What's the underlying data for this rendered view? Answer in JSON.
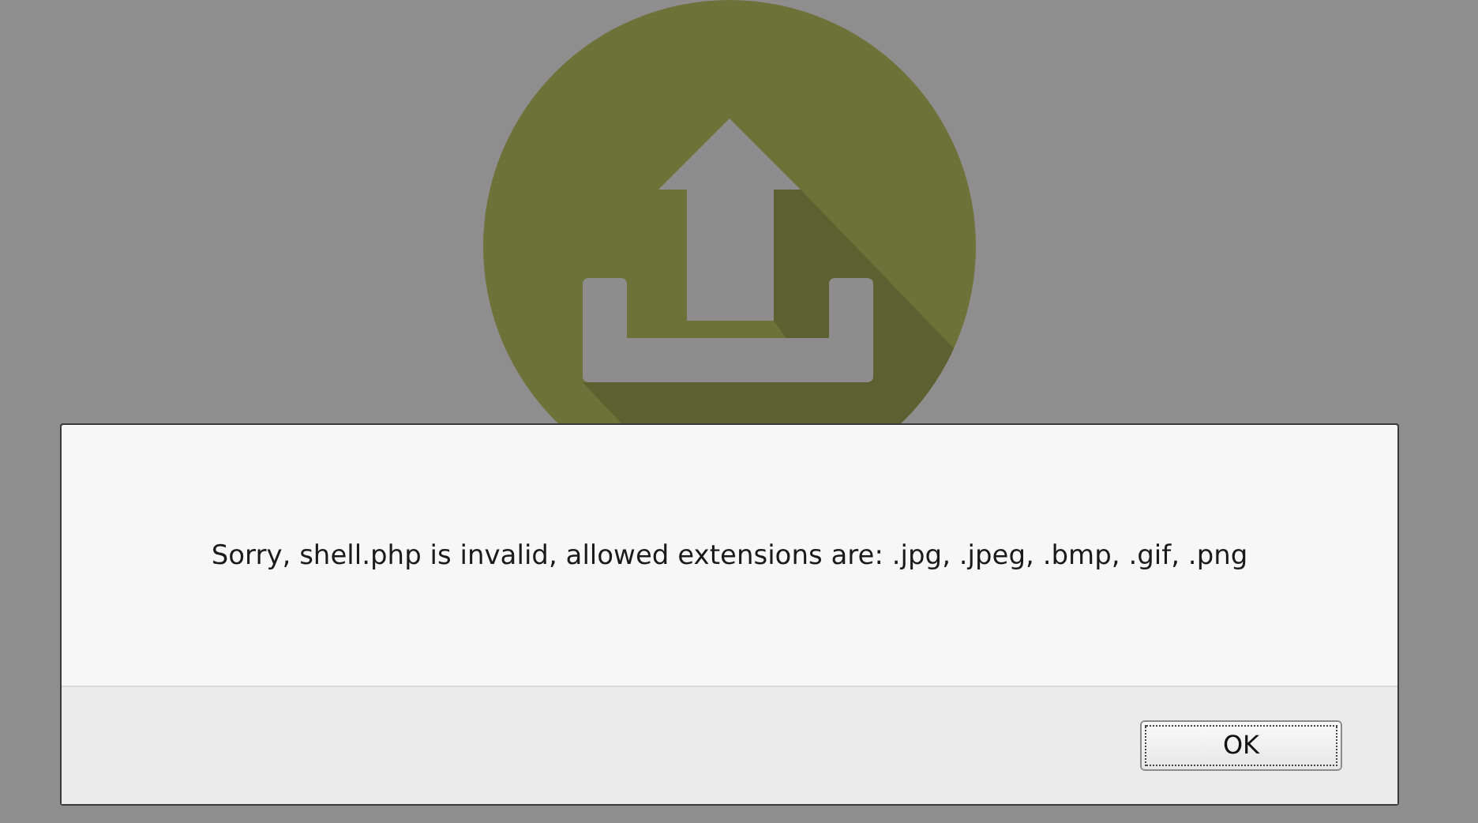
{
  "dialog": {
    "message": "Sorry, shell.php is invalid, allowed extensions are: .jpg, .jpeg, .bmp, .gif, .png",
    "buttons": [
      {
        "label": "OK",
        "focused": true
      }
    ]
  }
}
